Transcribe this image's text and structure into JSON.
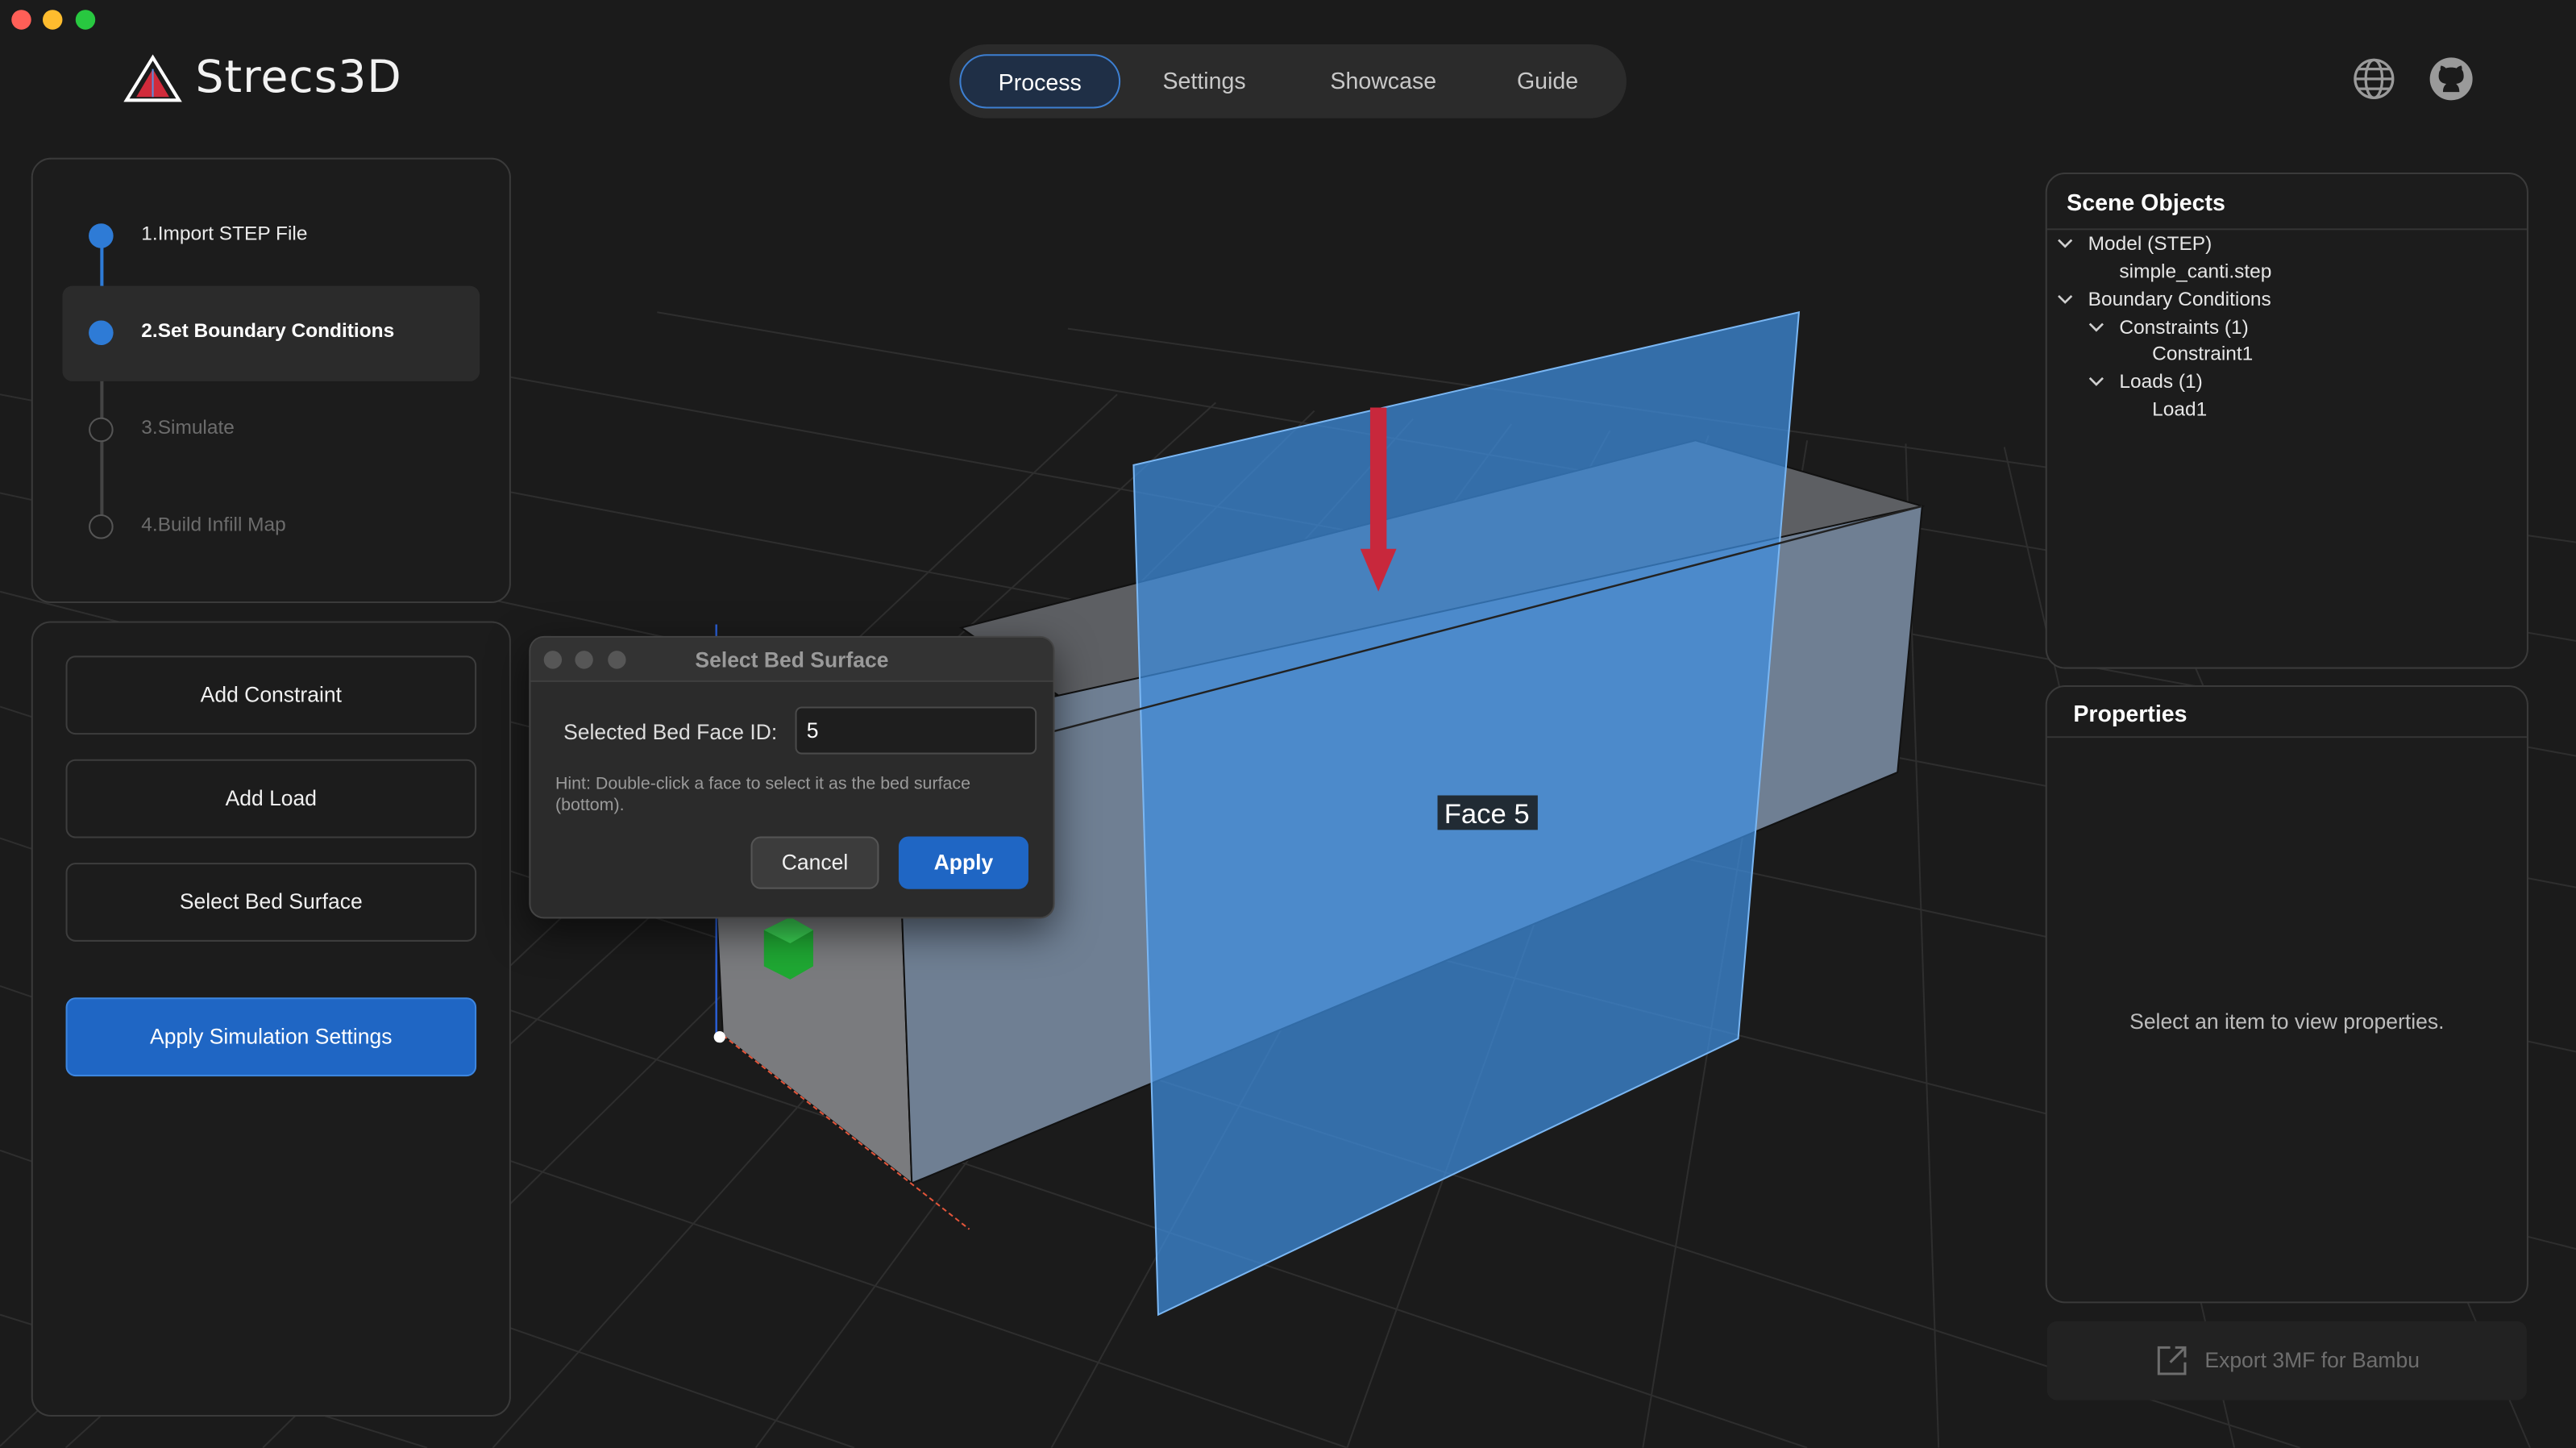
{
  "window": {
    "controls": [
      "close",
      "minimize",
      "maximize"
    ]
  },
  "brand": {
    "name": "Strecs3D",
    "logo_icon": "triangle-logo-icon"
  },
  "nav": {
    "tabs": [
      {
        "label": "Process",
        "active": true
      },
      {
        "label": "Settings",
        "active": false
      },
      {
        "label": "Showcase",
        "active": false
      },
      {
        "label": "Guide",
        "active": false
      }
    ]
  },
  "header_icons": [
    "globe-icon",
    "github-icon"
  ],
  "steps": [
    {
      "label": "1.Import STEP File",
      "state": "done"
    },
    {
      "label": "2.Set Boundary Conditions",
      "state": "current"
    },
    {
      "label": "3.Simulate",
      "state": "todo"
    },
    {
      "label": "4.Build Infill Map",
      "state": "todo"
    }
  ],
  "actions": {
    "add_constraint": "Add Constraint",
    "add_load": "Add Load",
    "select_bed_surface": "Select Bed Surface",
    "apply_simulation": "Apply Simulation Settings"
  },
  "scene_objects": {
    "title": "Scene Objects",
    "tree": [
      {
        "label": "Model (STEP)",
        "expanded": true
      },
      {
        "label": "simple_canti.step"
      },
      {
        "label": "Boundary Conditions",
        "expanded": true
      },
      {
        "label": "Constraints (1)",
        "expanded": true
      },
      {
        "label": "Constraint1"
      },
      {
        "label": "Loads (1)",
        "expanded": true
      },
      {
        "label": "Load1"
      }
    ]
  },
  "properties": {
    "title": "Properties",
    "empty_message": "Select an item to view properties."
  },
  "export": {
    "label": "Export 3MF for Bambu",
    "icon": "export-icon",
    "enabled": false
  },
  "viewport": {
    "face_label": "Face 5"
  },
  "dialog": {
    "title": "Select Bed Surface",
    "field_label": "Selected Bed Face ID:",
    "field_value": "5",
    "hint": "Hint: Double-click a face to select it as the bed surface (bottom).",
    "cancel": "Cancel",
    "apply": "Apply"
  },
  "colors": {
    "accent": "#1f66c4",
    "background": "#1b1b1b",
    "panel": "#1c1c1c",
    "selected_face": "#3f8fe0",
    "load_arrow": "#c8283c",
    "constraint": "#22b23a"
  }
}
